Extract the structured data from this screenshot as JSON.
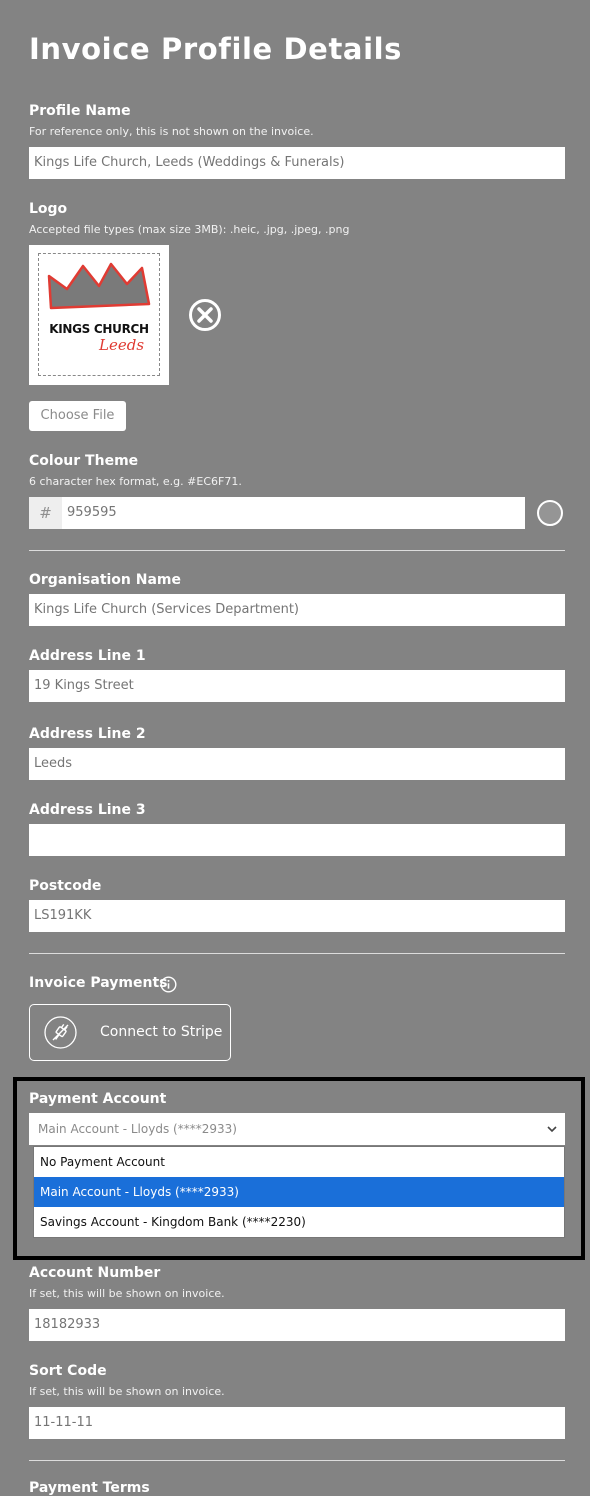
{
  "page": {
    "title": "Invoice Profile Details"
  },
  "profile_name": {
    "label": "Profile Name",
    "hint": "For reference only, this is not shown on the invoice.",
    "placeholder": "Kings Life Church, Leeds (Weddings & Funerals)"
  },
  "logo": {
    "label": "Logo",
    "hint": "Accepted file types (max size 3MB): .heic, .jpg, .jpeg, .png",
    "image_text_line1": "KINGS CHURCH",
    "image_text_line2": "Leeds",
    "choose_label": "Choose File",
    "remove_icon": "close-circle-icon"
  },
  "colour_theme": {
    "label": "Colour Theme",
    "hint": "6 character hex format, e.g. #EC6F71.",
    "prefix": "#",
    "placeholder": "959595",
    "swatch_color": "#959595"
  },
  "organisation": {
    "label": "Organisation Name",
    "placeholder": "Kings Life Church (Services Department)"
  },
  "address1": {
    "label": "Address Line 1",
    "placeholder": "19 Kings Street"
  },
  "address2": {
    "label": "Address Line 2",
    "placeholder": "Leeds"
  },
  "address3": {
    "label": "Address Line 3",
    "placeholder": ""
  },
  "postcode": {
    "label": "Postcode",
    "placeholder": "LS191KK"
  },
  "payments": {
    "label": "Invoice Payments",
    "info_icon": "info-icon",
    "stripe_label": "Connect to Stripe",
    "stripe_icon": "plug-icon"
  },
  "payment_account": {
    "label": "Payment Account",
    "selected": "Main Account - Lloyds (****2933)",
    "options": [
      "No Payment Account",
      "Main Account - Lloyds (****2933)",
      "Savings Account - Kingdom Bank (****2230)"
    ],
    "selected_color": "#1a6fd9"
  },
  "account_number": {
    "label": "Account Number",
    "hint": "If set, this will be shown on invoice.",
    "placeholder": "18182933"
  },
  "sort_code": {
    "label": "Sort Code",
    "hint": "If set, this will be shown on invoice.",
    "placeholder": "11-11-11"
  },
  "next_section": {
    "label": "Payment Terms"
  }
}
